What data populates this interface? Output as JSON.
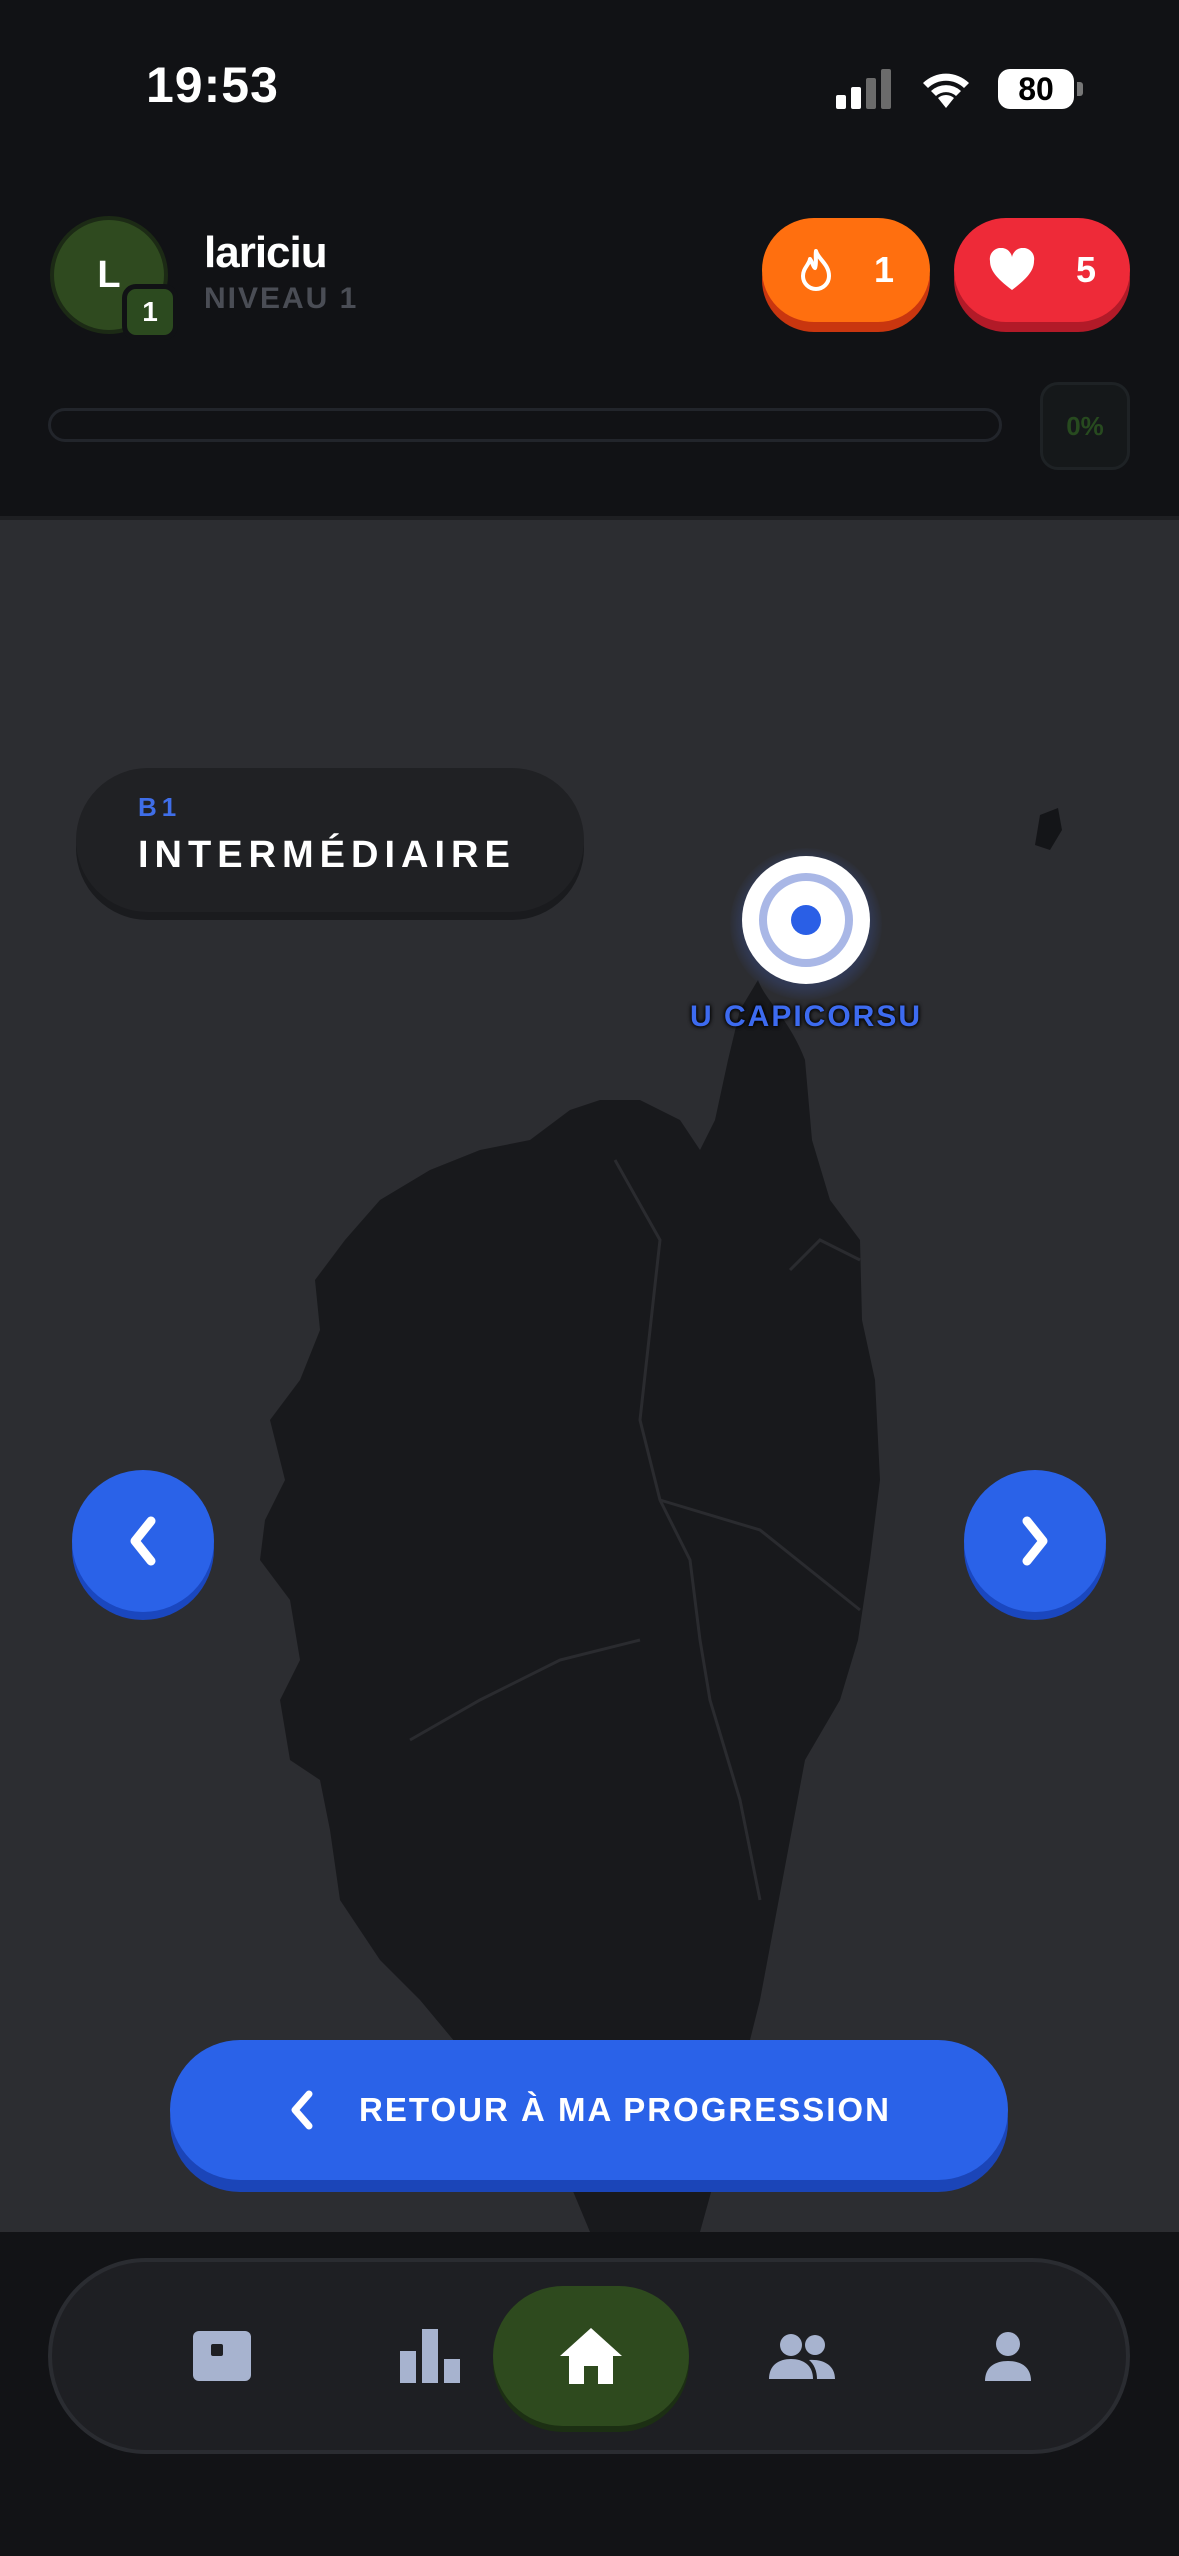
{
  "status_bar": {
    "time": "19:53",
    "battery": "80"
  },
  "header": {
    "avatar_initial": "L",
    "avatar_level": "1",
    "username": "lariciu",
    "level_label": "NIVEAU 1",
    "streak_count": "1",
    "lives_count": "5",
    "progress_fraction": 0,
    "progress_percent": "0%",
    "colors": {
      "streak": "#ff6f0f",
      "lives": "#ee2a38",
      "accent": "#2a62e8",
      "active_tab": "#2e4a1e"
    }
  },
  "map": {
    "level_code": "B1",
    "level_name": "INTERMÉDIAIRE",
    "node_label": "U CAPICORSU",
    "return_button": "RETOUR À MA PROGRESSION",
    "icons": {
      "prev": "chevron-left-icon",
      "next": "chevron-right-icon"
    }
  },
  "tabbar": {
    "items": [
      {
        "name": "lessons",
        "icon": "card-icon",
        "active": false
      },
      {
        "name": "leaderboard",
        "icon": "bar-chart-icon",
        "active": false
      },
      {
        "name": "home",
        "icon": "home-icon",
        "active": true
      },
      {
        "name": "friends",
        "icon": "people-icon",
        "active": false
      },
      {
        "name": "profile",
        "icon": "person-icon",
        "active": false
      }
    ]
  }
}
